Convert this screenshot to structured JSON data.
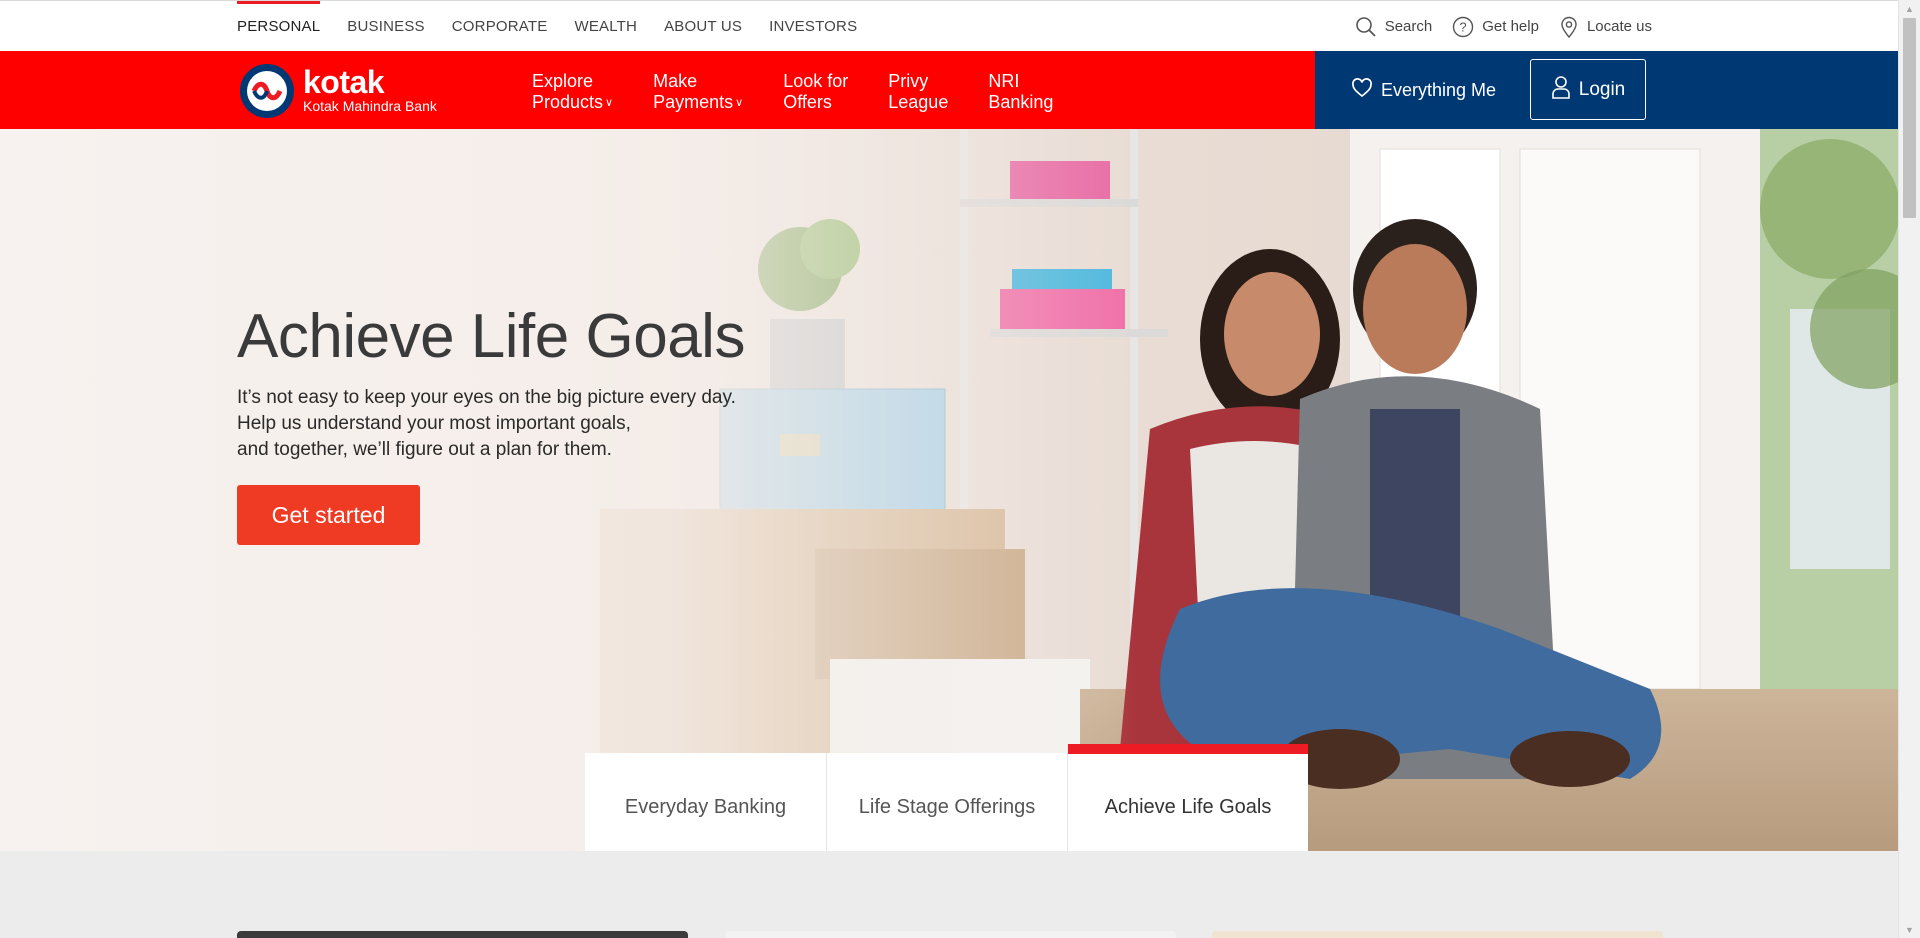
{
  "segments": [
    "PERSONAL",
    "BUSINESS",
    "CORPORATE",
    "WEALTH",
    "ABOUT US",
    "INVESTORS"
  ],
  "utilities": {
    "search": "Search",
    "help": "Get help",
    "locate": "Locate us"
  },
  "brand": {
    "name": "kotak",
    "subtitle": "Kotak Mahindra Bank"
  },
  "nav": {
    "explore": [
      "Explore",
      "Products"
    ],
    "payments": [
      "Make",
      "Payments"
    ],
    "offers": [
      "Look for",
      "Offers"
    ],
    "privy": [
      "Privy",
      "League"
    ],
    "nri": [
      "NRI",
      "Banking"
    ],
    "everything_me": "Everything Me",
    "login": "Login"
  },
  "hero": {
    "title": "Achieve Life Goals",
    "lines": [
      "It’s not easy to keep your eyes on the big picture every day.",
      "Help us understand your most important goals,",
      "and together, we’ll figure out a plan for them."
    ],
    "cta": "Get started"
  },
  "tabs": [
    "Everyday Banking",
    "Life Stage Offerings",
    "Achieve Life Goals"
  ],
  "active_tab": "Achieve Life Goals",
  "colors": {
    "brand_red": "#ff0000",
    "nav_blue": "#003874",
    "cta_orange": "#ef3b24",
    "accent_red": "#ed1c24"
  },
  "icons": [
    "search-icon",
    "help-icon",
    "location-icon",
    "heart-icon",
    "user-icon",
    "chevron-down-icon"
  ]
}
